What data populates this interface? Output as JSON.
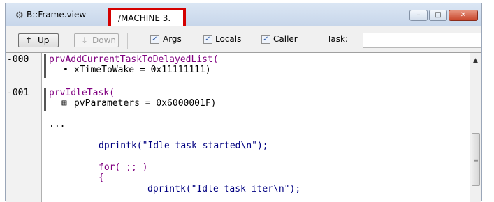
{
  "window": {
    "title": "B::Frame.view",
    "tab_label": "/MACHINE 3.",
    "controls": {
      "minimize": "–",
      "maximize": "□",
      "close": "✕"
    }
  },
  "toolbar": {
    "up_label": "Up",
    "down_label": "Down",
    "checkboxes": [
      {
        "label": "Args",
        "checked": true
      },
      {
        "label": "Locals",
        "checked": true
      },
      {
        "label": "Caller",
        "checked": true
      }
    ],
    "task_label": "Task:",
    "task_value": ""
  },
  "stack": {
    "frames": [
      {
        "number": "-000",
        "function": "prvAddCurrentTaskToDelayedList(",
        "param": "xTimeToWake = 0x11111111)"
      },
      {
        "number": "-001",
        "function": "prvIdleTask(",
        "param": "pvParameters = 0x6000001F)"
      }
    ],
    "ellipsis": "...",
    "source_lines": [
      "dprintk(\"Idle task started\\n\");",
      "for( ;; )",
      "{",
      "dprintk(\"Idle task iter\\n\");"
    ]
  },
  "icons": {
    "window": "frame-view-icon",
    "up": "up-arrow-icon",
    "down": "down-arrow-icon",
    "bullet": "bullet-icon",
    "expand": "expand-plus-icon",
    "scroll_up": "scroll-up-arrow-icon",
    "scroll_grip": "scroll-grip-icon"
  },
  "colors": {
    "highlight_border": "#d40000",
    "function_name": "#800080",
    "source_code": "#000080",
    "keyword": "#800080"
  }
}
